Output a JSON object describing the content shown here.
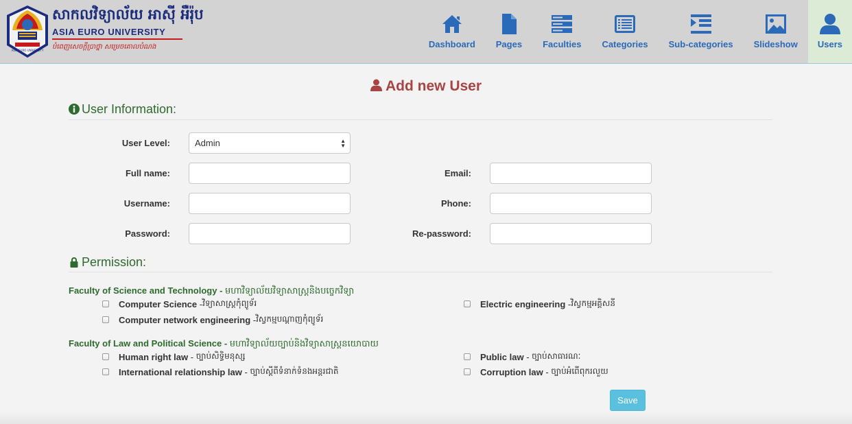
{
  "header": {
    "brand_khmer": "សាកលវិទ្យាល័យ អាស៊ី អឺរ៉ុប",
    "brand_english": "ASIA EURO UNIVERSITY",
    "brand_slogan": "បំពេញសេចក្តីប្រាថ្នា សម្រេចគោលបំណង",
    "logo_caption": "ASIA EURO UNIVERSITY"
  },
  "nav": [
    {
      "label": "Dashboard",
      "icon": "home-icon",
      "active": false
    },
    {
      "label": "Pages",
      "icon": "file-icon",
      "active": false
    },
    {
      "label": "Faculties",
      "icon": "server-icon",
      "active": false
    },
    {
      "label": "Categories",
      "icon": "list-alt-icon",
      "active": false
    },
    {
      "label": "Sub-categories",
      "icon": "indent-icon",
      "active": false
    },
    {
      "label": "Slideshow",
      "icon": "picture-icon",
      "active": false
    },
    {
      "label": "Users",
      "icon": "user-icon",
      "active": true
    }
  ],
  "page": {
    "title": "Add new User",
    "title_icon": "user-icon"
  },
  "user_info": {
    "heading": "User Information:",
    "heading_icon": "info-circle-icon",
    "user_level_label": "User Level:",
    "user_level_value": "Admin",
    "full_name_label": "Full name:",
    "full_name_value": "",
    "email_label": "Email:",
    "email_value": "",
    "username_label": "Username:",
    "username_value": "",
    "phone_label": "Phone:",
    "phone_value": "",
    "password_label": "Password:",
    "password_value": "",
    "repassword_label": "Re-password:",
    "repassword_value": ""
  },
  "permission": {
    "heading": "Permission:",
    "heading_icon": "lock-icon",
    "faculties": [
      {
        "name": "Faculty of Science and Technology",
        "name_kh": "មហាវិទ្យាល័យវិទ្យាសាស្ត្រនិងបច្ចេកវិទ្យា",
        "items": [
          {
            "en": "Computer Science",
            "kh": "វិទ្យាសាស្ត្រកុំព្យូទ័រ",
            "checked": false
          },
          {
            "en": "Electric engineering",
            "kh": "វិស្វកម្មអគ្គិសនី",
            "checked": false
          },
          {
            "en": "Computer network engineering",
            "kh": "វិស្វកម្មបណ្តាញកុំព្យូទ័រ",
            "checked": false
          }
        ]
      },
      {
        "name": "Faculty of Law and Political Science",
        "name_kh": "មហាវិទ្យាល័យច្បាប់និងវិទ្យាសាស្ត្រនយោបាយ",
        "items": [
          {
            "en": "Human right law",
            "kh": "ច្បាប់សិទ្ធិមនុស្ស",
            "checked": false
          },
          {
            "en": "Public law",
            "kh": "ច្បាប់សាធារណៈ",
            "checked": false
          },
          {
            "en": "International relationship law",
            "kh": "ច្បាប់ស្តីពីទំនាក់ទំនងអន្តរជាតិ",
            "checked": false
          },
          {
            "en": "Corruption law",
            "kh": "ច្បាប់អំពើពុករលួយ",
            "checked": false
          }
        ]
      }
    ]
  },
  "actions": {
    "save_label": "Save"
  },
  "colors": {
    "header_bg": "#d3d3d3",
    "nav_link": "#2a6ab8",
    "nav_active_bg": "#dcebd6",
    "title_red": "#a94442",
    "section_green": "#2e6b2e",
    "save_button": "#5bc0de"
  }
}
